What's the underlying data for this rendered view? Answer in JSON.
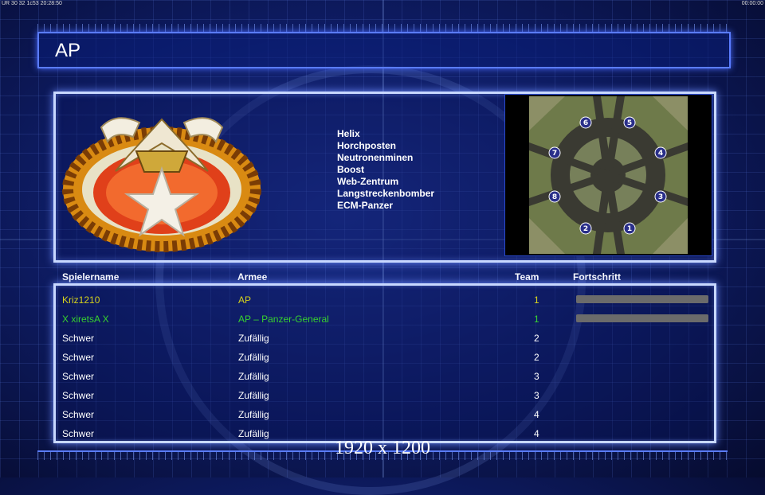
{
  "topbar": {
    "left": "UR 30 32 1c53 20:28:50",
    "right": "00:00:00"
  },
  "title": "AP",
  "units": [
    "Helix",
    "Horchposten",
    "Neutronenminen",
    "Boost",
    "Web-Zentrum",
    "Langstreckenbomber",
    "ECM-Panzer"
  ],
  "map_slots": [
    "6",
    "5",
    "7",
    "4",
    "8",
    "3",
    "2",
    "1"
  ],
  "headers": {
    "name": "Spielername",
    "army": "Armee",
    "team": "Team",
    "progress": "Fortschritt"
  },
  "players": [
    {
      "name": "Kriz1210",
      "army": "AP",
      "team": "1",
      "color": "#d6d21c",
      "progress": 1.0
    },
    {
      "name": "X xiretsA X",
      "army": "AP – Panzer-General",
      "team": "1",
      "color": "#37d12f",
      "progress": 1.0
    },
    {
      "name": "Schwer",
      "army": "Zufällig",
      "team": "2",
      "color": "#ffffff"
    },
    {
      "name": "Schwer",
      "army": "Zufällig",
      "team": "2",
      "color": "#ffffff"
    },
    {
      "name": "Schwer",
      "army": "Zufällig",
      "team": "3",
      "color": "#ffffff"
    },
    {
      "name": "Schwer",
      "army": "Zufällig",
      "team": "3",
      "color": "#ffffff"
    },
    {
      "name": "Schwer",
      "army": "Zufällig",
      "team": "4",
      "color": "#ffffff"
    },
    {
      "name": "Schwer",
      "army": "Zufällig",
      "team": "4",
      "color": "#ffffff"
    }
  ],
  "resolution_caption": "1920 x 1200"
}
